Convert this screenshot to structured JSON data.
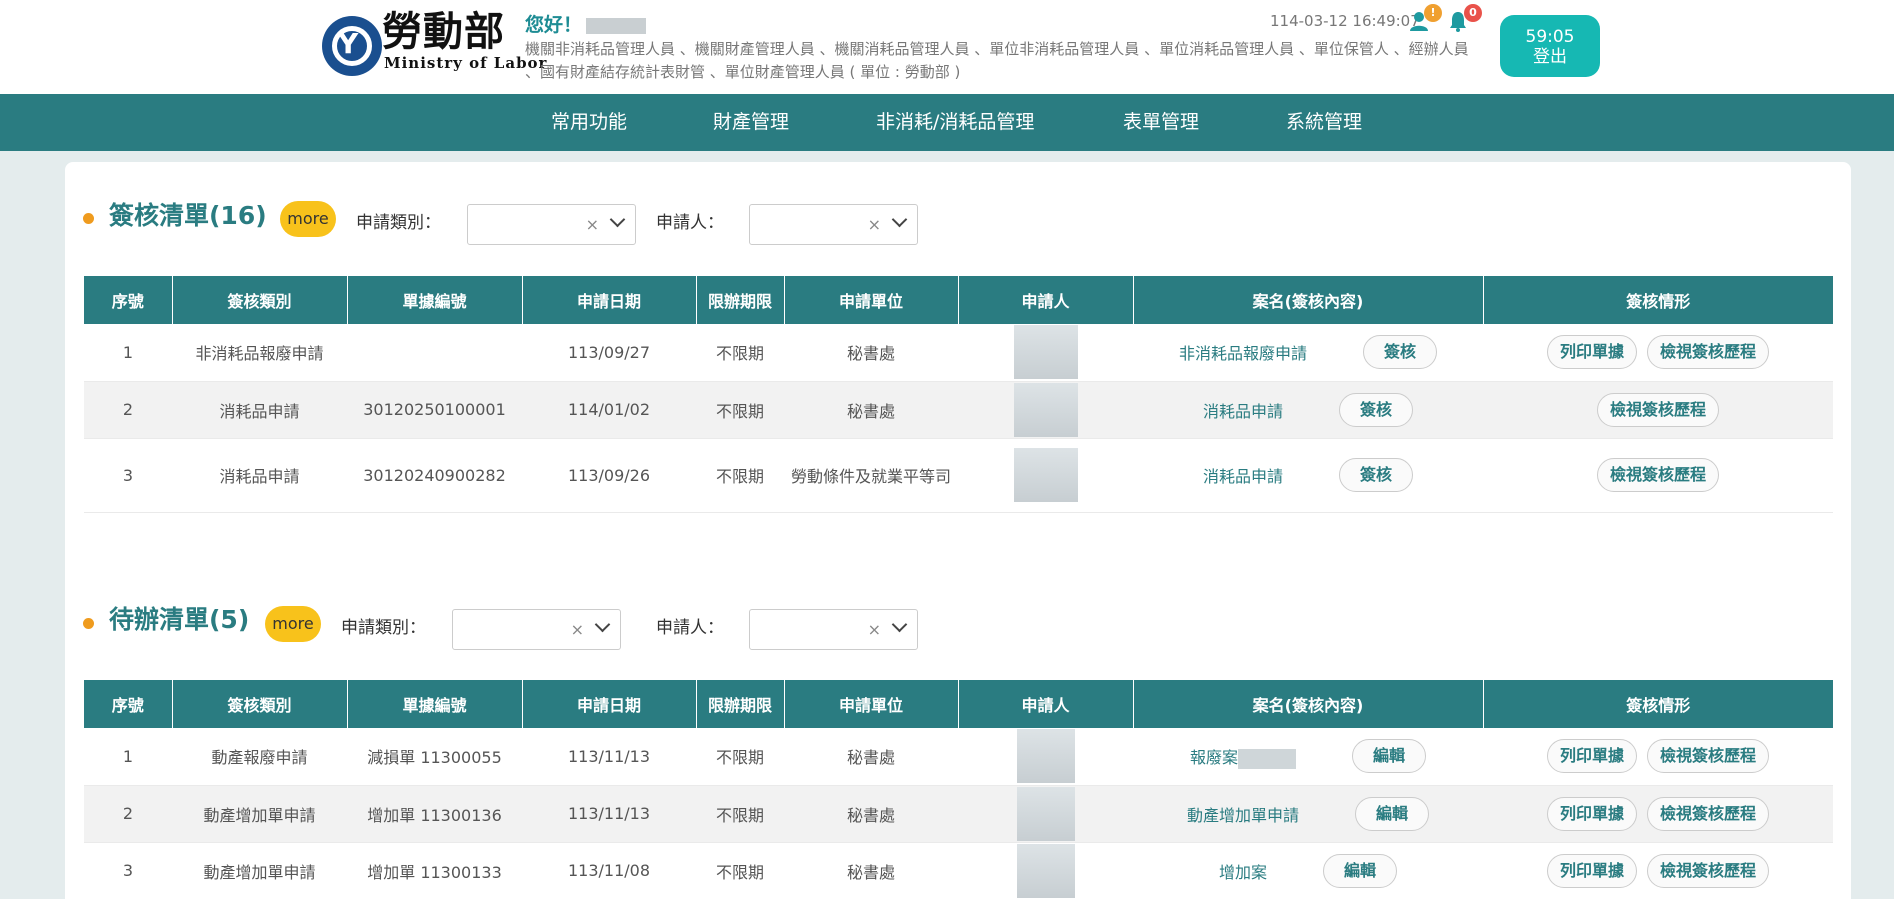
{
  "header": {
    "brand_cn": "勞動部",
    "brand_en": "Ministry of Labor",
    "greeting": "您好！",
    "roles": "機關非消耗品管理人員 、機關財產管理人員 、機關消耗品管理人員 、單位非消耗品管理人員 、單位消耗品管理人員 、單位保管人 、經辦人員 、國有財產結存統計表財管 、單位財產管理人員 ( 單位 : 勞動部 )",
    "datetime": "114-03-12 16:49:07",
    "user_badge": "!",
    "bell_badge": "0",
    "session_timer": "59:05",
    "logout_label": "登出",
    "colors": {
      "primary": "#2a7c81",
      "accent": "#16b8b3",
      "highlight": "#f8c21b"
    }
  },
  "nav": {
    "items": [
      "常用功能",
      "財產管理",
      "非消耗/消耗品管理",
      "表單管理",
      "系統管理"
    ]
  },
  "filters": {
    "type_label": "申請類別：",
    "applicant_label": "申請人：",
    "clear_glyph": "×"
  },
  "columns": [
    "序號",
    "簽核類別",
    "單據編號",
    "申請日期",
    "限辦期限",
    "申請單位",
    "申請人",
    "案名(簽核內容)",
    "簽核情形"
  ],
  "review": {
    "title": "簽核清單(16)",
    "more": "more",
    "rows": [
      {
        "no": "1",
        "type": "非消耗品報廢申請",
        "doc": "",
        "date": "113/09/27",
        "limit": "不限期",
        "unit": "秘書處",
        "case": "非消耗品報廢申請",
        "action": "簽核",
        "status_buttons": [
          "列印單據",
          "檢視簽核歷程"
        ]
      },
      {
        "no": "2",
        "type": "消耗品申請",
        "doc": "30120250100001",
        "date": "114/01/02",
        "limit": "不限期",
        "unit": "秘書處",
        "case": "消耗品申請",
        "action": "簽核",
        "status_buttons": [
          "檢視簽核歷程"
        ]
      },
      {
        "no": "3",
        "type": "消耗品申請",
        "doc": "30120240900282",
        "date": "113/09/26",
        "limit": "不限期",
        "unit": "勞動條件及就業平等司",
        "case": "消耗品申請",
        "action": "簽核",
        "status_buttons": [
          "檢視簽核歷程"
        ]
      }
    ]
  },
  "todo": {
    "title": "待辦清單(5)",
    "more": "more",
    "rows": [
      {
        "no": "1",
        "type": "動產報廢申請",
        "doc": "減損單 11300055",
        "date": "113/11/13",
        "limit": "不限期",
        "unit": "秘書處",
        "case": "報廢案",
        "action": "編輯",
        "status_buttons": [
          "列印單據",
          "檢視簽核歷程"
        ]
      },
      {
        "no": "2",
        "type": "動產增加單申請",
        "doc": "增加單 11300136",
        "date": "113/11/13",
        "limit": "不限期",
        "unit": "秘書處",
        "case": "動產增加單申請",
        "action": "編輯",
        "status_buttons": [
          "列印單據",
          "檢視簽核歷程"
        ]
      },
      {
        "no": "3",
        "type": "動產增加單申請",
        "doc": "增加單 11300133",
        "date": "113/11/08",
        "limit": "不限期",
        "unit": "秘書處",
        "case": "增加案",
        "action": "編輯",
        "status_buttons": [
          "列印單據",
          "檢視簽核歷程"
        ]
      }
    ]
  }
}
